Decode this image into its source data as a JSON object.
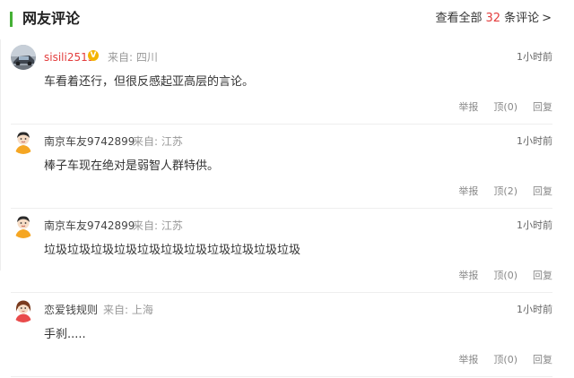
{
  "header": {
    "title": "网友评论",
    "view_all_prefix": "查看全部",
    "view_all_count": "32",
    "view_all_suffix": "条评论",
    "arrow": ">"
  },
  "actions": {
    "report": "举报",
    "reply": "回复"
  },
  "comments": [
    {
      "username": "sisili2513",
      "vip_badge": "V",
      "from": "来自: 四川",
      "time": "1小时前",
      "content": "车看着还行，但很反感起亚高层的言论。",
      "upvote": "顶(0)"
    },
    {
      "username": "南京车友9742899",
      "from": "来自: 江苏",
      "time": "1小时前",
      "content": "棒子车现在绝对是弱智人群特供。",
      "upvote": "顶(2)"
    },
    {
      "username": "南京车友9742899",
      "from": "来自: 江苏",
      "time": "1小时前",
      "content": "垃圾垃圾垃圾垃圾垃圾垃圾垃圾垃圾垃圾垃圾垃圾",
      "upvote": "顶(0)"
    },
    {
      "username": "恋爱钱规则",
      "from": "来自: 上海",
      "time": "1小时前",
      "content": "手刹.....",
      "upvote": "顶(0)"
    }
  ]
}
